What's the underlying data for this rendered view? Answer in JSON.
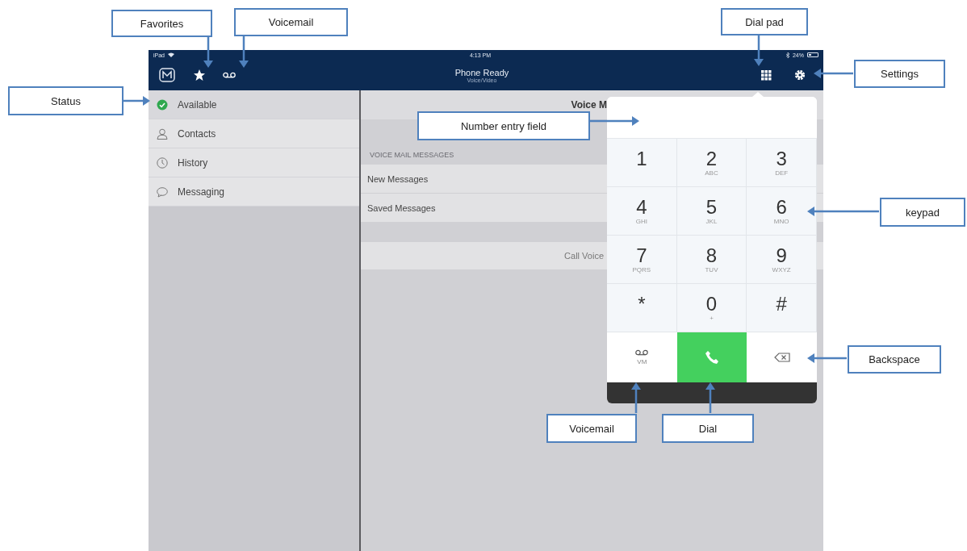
{
  "status_bar": {
    "device": "iPad",
    "time": "4:13 PM",
    "battery": "24%"
  },
  "header": {
    "title": "Phone Ready",
    "subtitle": "Voice/Video"
  },
  "sidebar": {
    "items": [
      {
        "kind": "status",
        "label": "Available",
        "selected": true
      },
      {
        "kind": "contacts",
        "label": "Contacts",
        "selected": false
      },
      {
        "kind": "history",
        "label": "History",
        "selected": false
      },
      {
        "kind": "messaging",
        "label": "Messaging",
        "selected": false
      }
    ]
  },
  "panel": {
    "title": "Voice M",
    "section": "VOICE MAIL MESSAGES",
    "rows": [
      "New Messages",
      "Saved Messages"
    ],
    "action": "Call Voice"
  },
  "dialpad": {
    "keys": [
      {
        "digit": "1"
      },
      {
        "digit": "2",
        "letters": "ABC"
      },
      {
        "digit": "3",
        "letters": "DEF"
      },
      {
        "digit": "4",
        "letters": "GHI"
      },
      {
        "digit": "5",
        "letters": "JKL"
      },
      {
        "digit": "6",
        "letters": "MNO"
      },
      {
        "digit": "7",
        "letters": "PQRS"
      },
      {
        "digit": "8",
        "letters": "TUV"
      },
      {
        "digit": "9",
        "letters": "WXYZ"
      },
      {
        "digit": "*"
      },
      {
        "digit": "0",
        "letters": "+"
      },
      {
        "digit": "#"
      }
    ],
    "voicemail_label": "VM"
  },
  "annotations": [
    {
      "text": "Favorites"
    },
    {
      "text": "Voicemail"
    },
    {
      "text": "Dial pad"
    },
    {
      "text": "Settings"
    },
    {
      "text": "Status"
    },
    {
      "text": "Number entry field"
    },
    {
      "text": "keypad"
    },
    {
      "text": "Backspace"
    },
    {
      "text": "Voicemail"
    },
    {
      "text": "Dial"
    }
  ]
}
